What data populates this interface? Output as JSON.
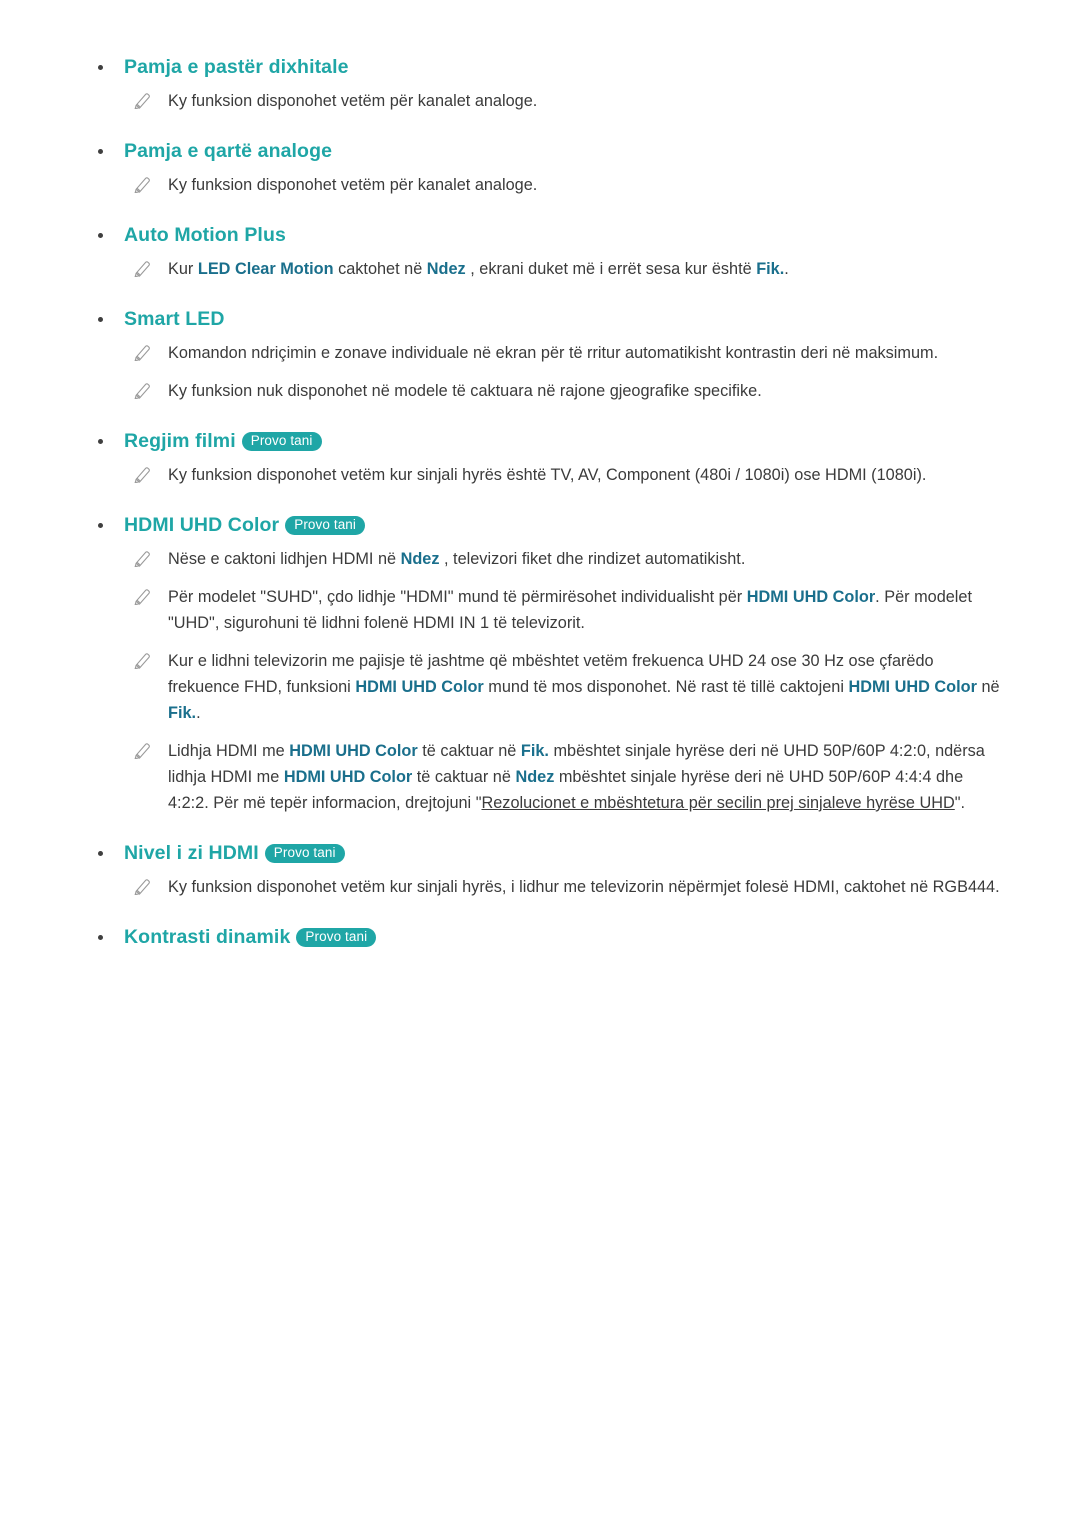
{
  "page": {
    "try_now_label": "Provo tani",
    "sections": [
      {
        "id": "pamja-e-paster-dixhitale",
        "title": "Pamja e pastër dixhitale",
        "badge": null,
        "notes": [
          {
            "id": "note-1",
            "parts": [
              {
                "t": "Ky funksion disponohet vetëm për kanalet analoge."
              }
            ]
          }
        ]
      },
      {
        "id": "pamja-e-qarte-analoge",
        "title": "Pamja e qartë analoge",
        "badge": null,
        "notes": [
          {
            "id": "note-2",
            "parts": [
              {
                "t": "Ky funksion disponohet vetëm për kanalet analoge."
              }
            ]
          }
        ]
      },
      {
        "id": "auto-motion-plus",
        "title": "Auto Motion Plus",
        "badge": null,
        "notes": [
          {
            "id": "note-3",
            "parts": [
              {
                "t": "Kur "
              },
              {
                "t": "LED Clear Motion",
                "s": "tok"
              },
              {
                "t": " caktohet në "
              },
              {
                "t": "Ndez",
                "s": "tok"
              },
              {
                "t": " , ekrani duket më i errët sesa kur është "
              },
              {
                "t": "Fik.",
                "s": "tok"
              },
              {
                "t": "."
              }
            ]
          }
        ]
      },
      {
        "id": "smart-led",
        "title": "Smart LED",
        "badge": null,
        "notes": [
          {
            "id": "note-4",
            "parts": [
              {
                "t": "Komandon ndriçimin e zonave individuale në ekran për të rritur automatikisht kontrastin deri në maksimum."
              }
            ]
          },
          {
            "id": "note-5",
            "parts": [
              {
                "t": "Ky funksion nuk disponohet në modele të caktuara në rajone gjeografike specifike."
              }
            ]
          }
        ]
      },
      {
        "id": "regjim-filmi",
        "title": "Regjim filmi",
        "badge": "Provo tani",
        "notes": [
          {
            "id": "note-6",
            "parts": [
              {
                "t": "Ky funksion disponohet vetëm kur sinjali hyrës është TV, AV, Component (480i / 1080i) ose HDMI (1080i)."
              }
            ]
          }
        ]
      },
      {
        "id": "hdmi-uhd-color",
        "title": "HDMI UHD Color",
        "badge": "Provo tani",
        "notes": [
          {
            "id": "note-7",
            "parts": [
              {
                "t": "Nëse e caktoni lidhjen HDMI në "
              },
              {
                "t": "Ndez",
                "s": "tok"
              },
              {
                "t": " , televizori fiket dhe rindizet automatikisht."
              }
            ]
          },
          {
            "id": "note-8",
            "parts": [
              {
                "t": "Për modelet \"SUHD\", çdo lidhje \"HDMI\" mund të përmirësohet individualisht për "
              },
              {
                "t": "HDMI UHD Color",
                "s": "tok"
              },
              {
                "t": ". Për modelet \"UHD\", sigurohuni të lidhni folenë HDMI IN 1 të televizorit."
              }
            ]
          },
          {
            "id": "note-9",
            "parts": [
              {
                "t": "Kur e lidhni televizorin me pajisje të jashtme që mbështet vetëm frekuenca UHD 24 ose 30 Hz ose çfarëdo frekuence FHD, funksioni "
              },
              {
                "t": "HDMI UHD Color",
                "s": "tok"
              },
              {
                "t": " mund të mos disponohet. Në rast të tillë caktojeni "
              },
              {
                "t": "HDMI UHD Color",
                "s": "tok"
              },
              {
                "t": " në "
              },
              {
                "t": "Fik.",
                "s": "tok"
              },
              {
                "t": "."
              }
            ]
          },
          {
            "id": "note-10",
            "parts": [
              {
                "t": "Lidhja HDMI me "
              },
              {
                "t": "HDMI UHD Color",
                "s": "tok"
              },
              {
                "t": " të caktuar në "
              },
              {
                "t": "Fik.",
                "s": "tok"
              },
              {
                "t": " mbështet sinjale hyrëse deri në UHD 50P/60P 4:2:0, ndërsa lidhja HDMI me "
              },
              {
                "t": "HDMI UHD Color",
                "s": "tok"
              },
              {
                "t": " të caktuar në "
              },
              {
                "t": "Ndez",
                "s": "tok"
              },
              {
                "t": " mbështet sinjale hyrëse deri në UHD 50P/60P 4:4:4 dhe 4:2:2. Për më tepër informacion, drejtojuni \""
              },
              {
                "t": "Rezolucionet e mbështetura për secilin prej sinjaleve hyrëse UHD",
                "s": "link-u"
              },
              {
                "t": "\"."
              }
            ]
          }
        ]
      },
      {
        "id": "nivel-i-zi-hdmi",
        "title": "Nivel i zi HDMI",
        "badge": "Provo tani",
        "notes": [
          {
            "id": "note-11",
            "parts": [
              {
                "t": "Ky funksion disponohet vetëm kur sinjali hyrës, i lidhur me televizorin nëpërmjet folesë HDMI, caktohet në RGB444."
              }
            ]
          }
        ]
      },
      {
        "id": "kontrasti-dinamik",
        "title": "Kontrasti dinamik",
        "badge": "Provo tani",
        "notes": []
      }
    ]
  }
}
